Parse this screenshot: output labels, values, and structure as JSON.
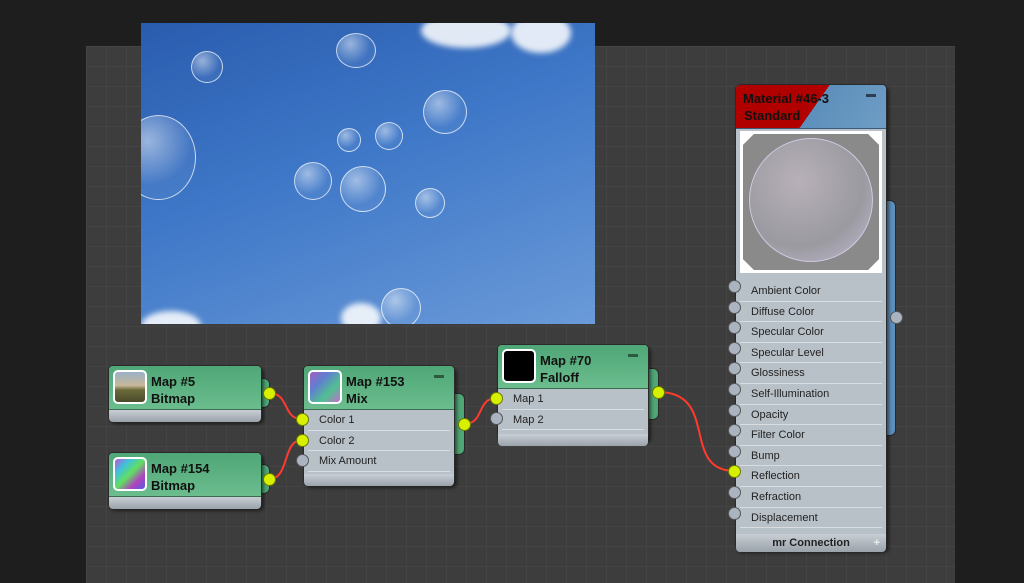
{
  "photo": {
    "label": "bubbles-in-sky-image"
  },
  "nodes": {
    "map5": {
      "title": "Map #5",
      "type": "Bitmap"
    },
    "map154": {
      "title": "Map #154",
      "type": "Bitmap"
    },
    "mix": {
      "title": "Map #153",
      "type": "Mix",
      "inputs": [
        "Color 1",
        "Color 2",
        "Mix Amount"
      ]
    },
    "falloff": {
      "title": "Map #70",
      "type": "Falloff",
      "inputs": [
        "Map 1",
        "Map 2"
      ]
    },
    "material": {
      "title": "Material #46-3",
      "type": "Standard",
      "inputs": [
        "Ambient Color",
        "Diffuse Color",
        "Specular Color",
        "Specular Level",
        "Glossiness",
        "Self-Illumination",
        "Opacity",
        "Filter Color",
        "Bump",
        "Reflection",
        "Refraction",
        "Displacement"
      ],
      "footer": "mr Connection",
      "footer_icon": "+"
    }
  },
  "colors": {
    "wire": "#ff3a2e",
    "socket_on": "#d7f000",
    "node_green": "#4fa676",
    "material_red": "#b00000",
    "material_blue": "#5c8fbb"
  }
}
